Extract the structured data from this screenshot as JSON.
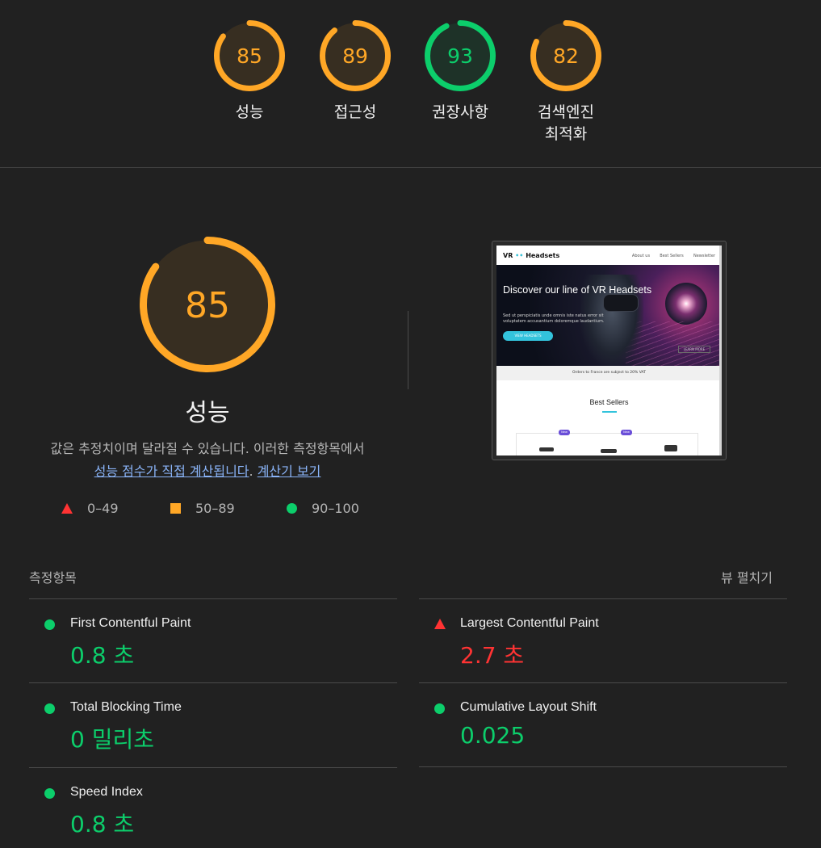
{
  "categories": [
    {
      "score": "85",
      "label": "성능",
      "color": "#ffa726",
      "value": 0.85
    },
    {
      "score": "89",
      "label": "접근성",
      "color": "#ffa726",
      "value": 0.89
    },
    {
      "score": "93",
      "label": "권장사항",
      "color": "#0cce6b",
      "value": 0.93
    },
    {
      "score": "82",
      "label": "검색엔진\n최적화",
      "color": "#ffa726",
      "value": 0.82
    }
  ],
  "performance": {
    "score": "85",
    "value": 0.85,
    "title": "성능",
    "desc_text": "값은 추정치이며 달라질 수 있습니다. 이러한 측정항목에서",
    "desc_link1": "성능 점수가 직접 계산됩니다",
    "desc_period": ".",
    "desc_link2": "계산기 보기"
  },
  "legend": {
    "fail": "0–49",
    "average": "50–89",
    "pass": "90–100"
  },
  "screenshot": {
    "logo_vr": "VR",
    "logo_dots": "••",
    "logo_text": "Headsets",
    "nav_links": [
      "About us",
      "Best Sellers",
      "Newsletter"
    ],
    "hero_title": "Discover our line of VR Headsets",
    "hero_text": "Sed ut perspiciatis unde omnis iste natus error sit voluptatem accusantium doloremque laudantium.",
    "hero_button": "VIEW HEADSETS",
    "hero_tag": "LEARN MORE",
    "notice": "Orders to France are subject to 20% VAT",
    "best_sellers": "Best Sellers",
    "badge": "New"
  },
  "metrics": {
    "header": "측정항목",
    "expand": "뷰 펼치기",
    "items": [
      {
        "title": "First Contentful Paint",
        "value": "0.8 초",
        "status": "pass"
      },
      {
        "title": "Largest Contentful Paint",
        "value": "2.7 초",
        "status": "fail"
      },
      {
        "title": "Total Blocking Time",
        "value": "0 밀리초",
        "status": "pass"
      },
      {
        "title": "Cumulative Layout Shift",
        "value": "0.025",
        "status": "pass"
      },
      {
        "title": "Speed Index",
        "value": "0.8 초",
        "status": "pass"
      }
    ]
  },
  "colors": {
    "pass": "#0cce6b",
    "average": "#ffa726",
    "fail": "#ff3333",
    "link": "#8ab4f8"
  }
}
